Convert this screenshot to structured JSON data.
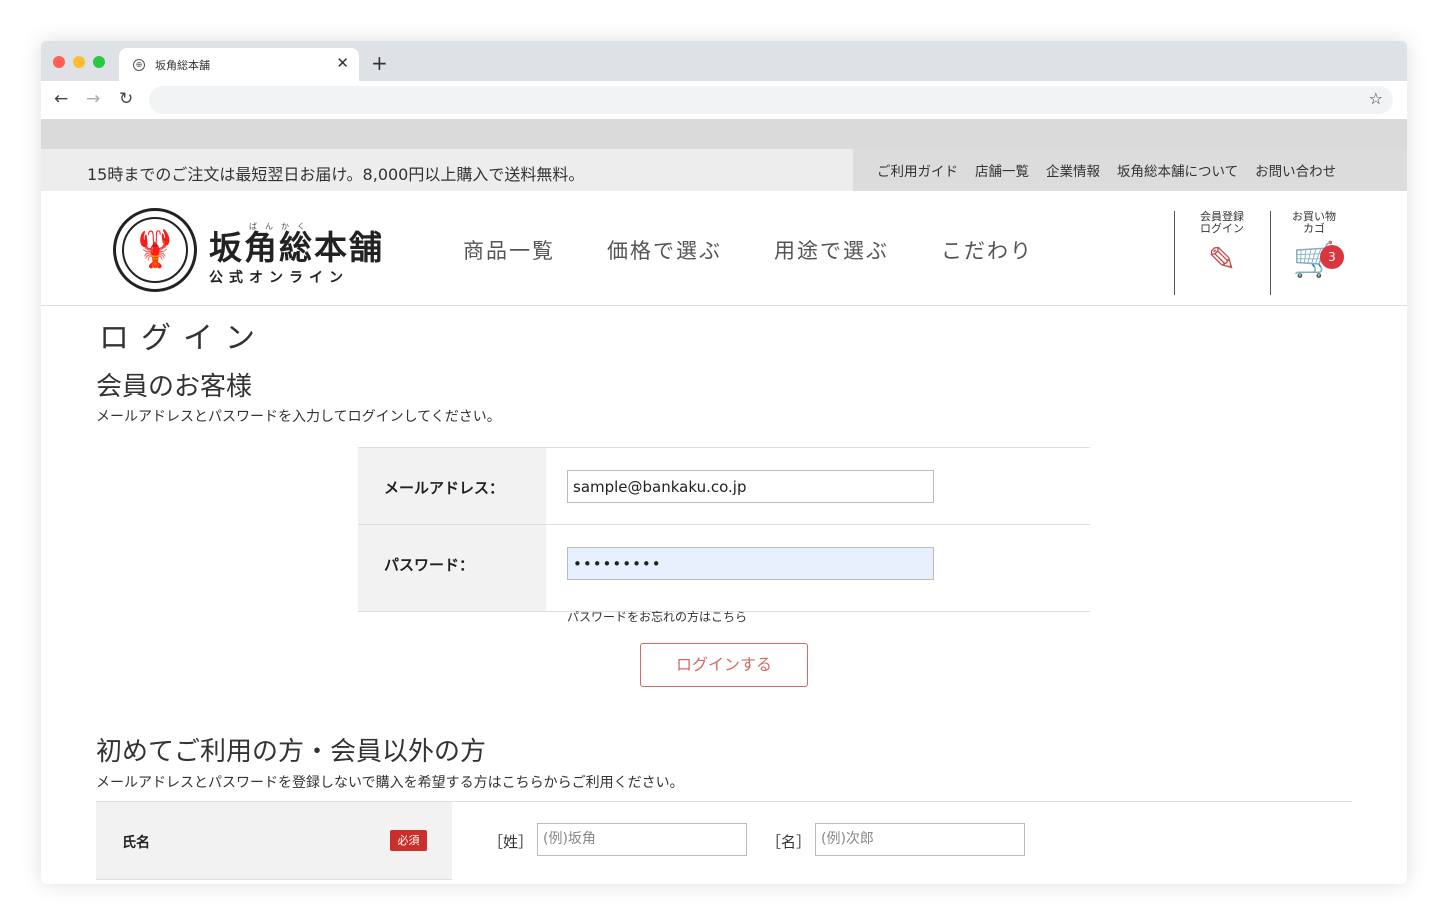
{
  "browser": {
    "tab_title": "坂角総本舗",
    "tab_icon": "globe-icon",
    "traffic_colors": [
      "#ff5f57",
      "#febc2e",
      "#28c840"
    ]
  },
  "topbar": {
    "notice": "15時までのご注文は最短翌日お届け。8,000円以上購入で送料無料。",
    "links": [
      "ご利用ガイド",
      "店舗一覧",
      "企業情報",
      "坂角総本舗について",
      "お問い合わせ"
    ]
  },
  "header": {
    "logo_name": "坂角総本舗",
    "logo_ruby": "ばんかく",
    "logo_sub": "公式オンライン",
    "nav": [
      "商品一覧",
      "価格で選ぶ",
      "用途で選ぶ",
      "こだわり"
    ],
    "account_label_1": "会員登録",
    "account_label_2": "ログイン",
    "cart_label_1": "お買い物",
    "cart_label_2": "カゴ",
    "cart_count": "3",
    "accent_color": "#c0504d"
  },
  "login": {
    "title": "ログイン",
    "member_heading": "会員のお客様",
    "member_desc": "メールアドレスとパスワードを入力してログインしてください。",
    "email_label": "メールアドレス：",
    "email_value": "sample@bankaku.co.jp",
    "password_label": "パスワード：",
    "password_value": "•••••••••",
    "forgot_link": "パスワードをお忘れの方はこちら",
    "login_button": "ログインする"
  },
  "guest": {
    "heading": "初めてご利用の方・会員以外の方",
    "desc": "メールアドレスとパスワードを登録しないで購入を希望する方はこちらからご利用ください。",
    "name_label": "氏名",
    "required_badge": "必須",
    "last_bracket": "［姓］",
    "last_placeholder": "(例)坂角",
    "first_bracket": "［名］",
    "first_placeholder": "(例)次郎"
  }
}
